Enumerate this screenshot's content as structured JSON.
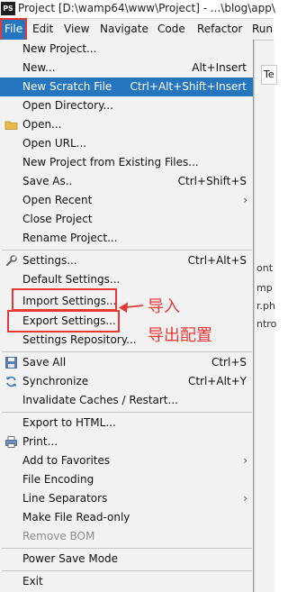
{
  "window": {
    "app_icon": "PS",
    "title": "Project [D:\\wamp64\\www\\Project] - ...\\blog\\app\\"
  },
  "menubar": [
    {
      "label": "File",
      "active": true
    },
    {
      "label": "Edit"
    },
    {
      "label": "View"
    },
    {
      "label": "Navigate"
    },
    {
      "label": "Code"
    },
    {
      "label": "Refactor"
    },
    {
      "label": "Run"
    }
  ],
  "background": {
    "tab_label": "Te",
    "lines": [
      "ont",
      "mp",
      "r.ph",
      "ntro"
    ]
  },
  "file_menu": [
    {
      "label": "New Project..."
    },
    {
      "label": "New...",
      "shortcut": "Alt+Insert"
    },
    {
      "label": "New Scratch File",
      "shortcut": "Ctrl+Alt+Shift+Insert",
      "highlighted": true
    },
    {
      "label": "Open Directory..."
    },
    {
      "label": "Open...",
      "icon": "folder-icon"
    },
    {
      "label": "Open URL..."
    },
    {
      "label": "New Project from Existing Files..."
    },
    {
      "label": "Save As..",
      "shortcut": "Ctrl+Shift+S"
    },
    {
      "label": "Open Recent",
      "submenu": true
    },
    {
      "label": "Close Project"
    },
    {
      "label": "Rename Project..."
    },
    {
      "label": "Settings...",
      "shortcut": "Ctrl+Alt+S",
      "icon": "wrench-icon"
    },
    {
      "label": "Default Settings..."
    },
    {
      "label": "Import Settings..."
    },
    {
      "label": "Export Settings..."
    },
    {
      "label": "Settings Repository..."
    },
    {
      "label": "Save All",
      "shortcut": "Ctrl+S",
      "icon": "save-icon"
    },
    {
      "label": "Synchronize",
      "shortcut": "Ctrl+Alt+Y",
      "icon": "sync-icon"
    },
    {
      "label": "Invalidate Caches / Restart..."
    },
    {
      "label": "Export to HTML..."
    },
    {
      "label": "Print...",
      "icon": "print-icon"
    },
    {
      "label": "Add to Favorites",
      "submenu": true
    },
    {
      "label": "File Encoding"
    },
    {
      "label": "Line Separators",
      "submenu": true
    },
    {
      "label": "Make File Read-only"
    },
    {
      "label": "Remove BOM",
      "disabled": true
    },
    {
      "label": "Power Save Mode"
    },
    {
      "label": "Exit"
    }
  ],
  "annotations": {
    "import_label": "导入",
    "export_label": "导出配置",
    "color": "#e53935"
  },
  "colors": {
    "highlight": "#2675bf",
    "menu_bg": "#f2f2f2"
  }
}
